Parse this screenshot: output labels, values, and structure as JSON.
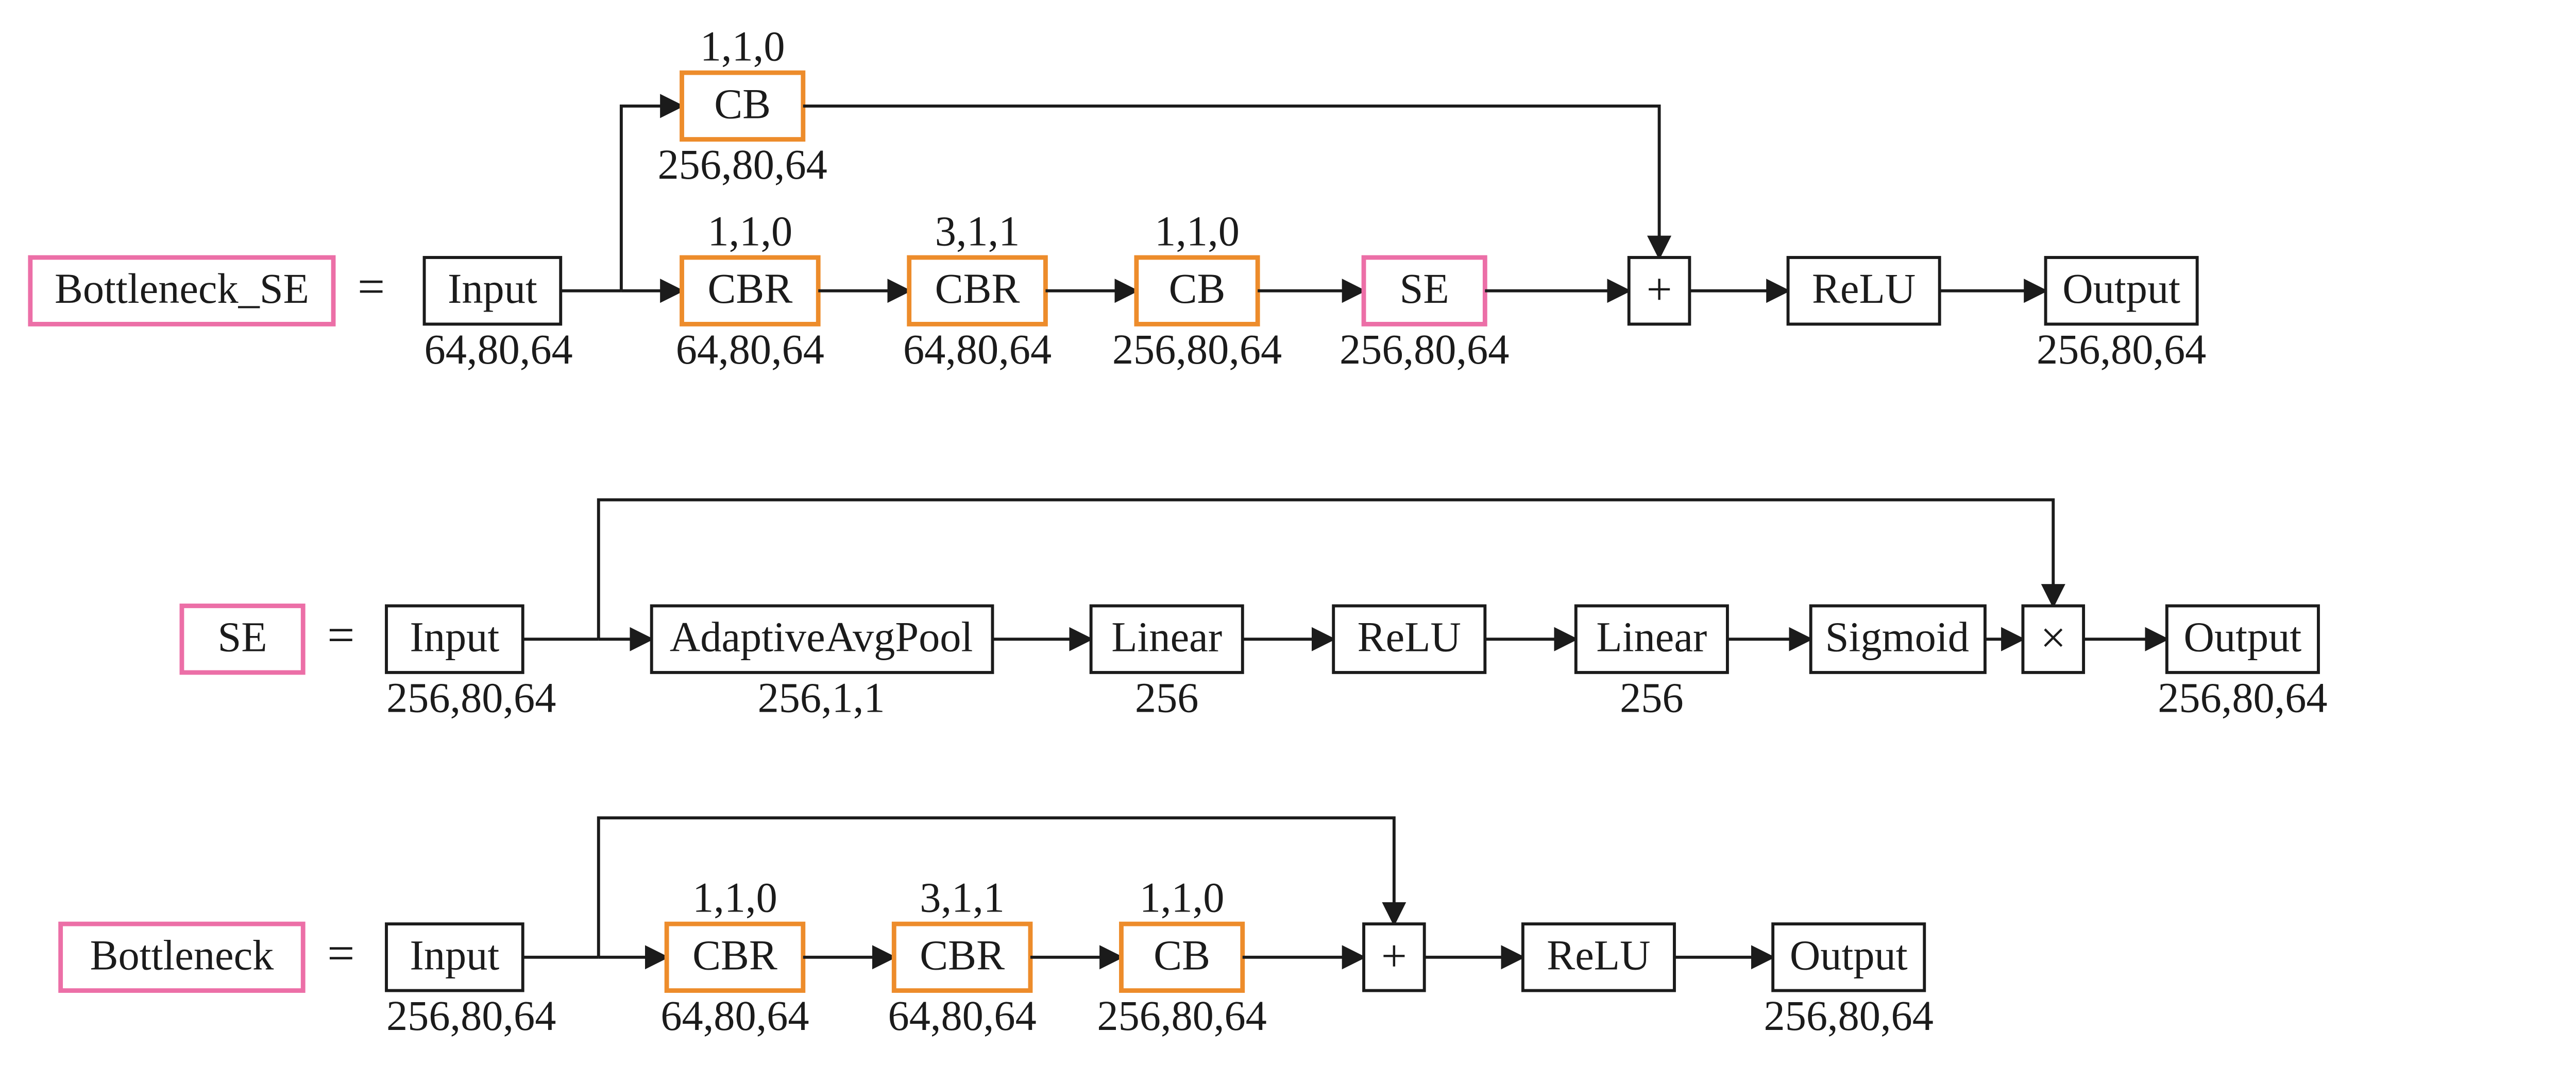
{
  "row1": {
    "title": "Bottleneck_SE",
    "eq": "=",
    "input": {
      "label": "Input",
      "shape": "64,80,64"
    },
    "shortcut": {
      "label": "CB",
      "params": "1,1,0",
      "shape": "256,80,64"
    },
    "cbr1": {
      "label": "CBR",
      "params": "1,1,0",
      "shape": "64,80,64"
    },
    "cbr2": {
      "label": "CBR",
      "params": "3,1,1",
      "shape": "64,80,64"
    },
    "cb": {
      "label": "CB",
      "params": "1,1,0",
      "shape": "256,80,64"
    },
    "se": {
      "label": "SE",
      "shape": "256,80,64"
    },
    "add": "+",
    "relu": "ReLU",
    "output": {
      "label": "Output",
      "shape": "256,80,64"
    }
  },
  "row2": {
    "title": "SE",
    "eq": "=",
    "input": {
      "label": "Input",
      "shape": "256,80,64"
    },
    "pool": {
      "label": "AdaptiveAvgPool",
      "shape": "256,1,1"
    },
    "lin1": {
      "label": "Linear",
      "shape": "256"
    },
    "relu": "ReLU",
    "lin2": {
      "label": "Linear",
      "shape": "256"
    },
    "sig": "Sigmoid",
    "mul": "×",
    "output": {
      "label": "Output",
      "shape": "256,80,64"
    }
  },
  "row3": {
    "title": "Bottleneck",
    "eq": "=",
    "input": {
      "label": "Input",
      "shape": "256,80,64"
    },
    "cbr1": {
      "label": "CBR",
      "params": "1,1,0",
      "shape": "64,80,64"
    },
    "cbr2": {
      "label": "CBR",
      "params": "3,1,1",
      "shape": "64,80,64"
    },
    "cb": {
      "label": "CB",
      "params": "1,1,0",
      "shape": "256,80,64"
    },
    "add": "+",
    "relu": "ReLU",
    "output": {
      "label": "Output",
      "shape": "256,80,64"
    }
  }
}
